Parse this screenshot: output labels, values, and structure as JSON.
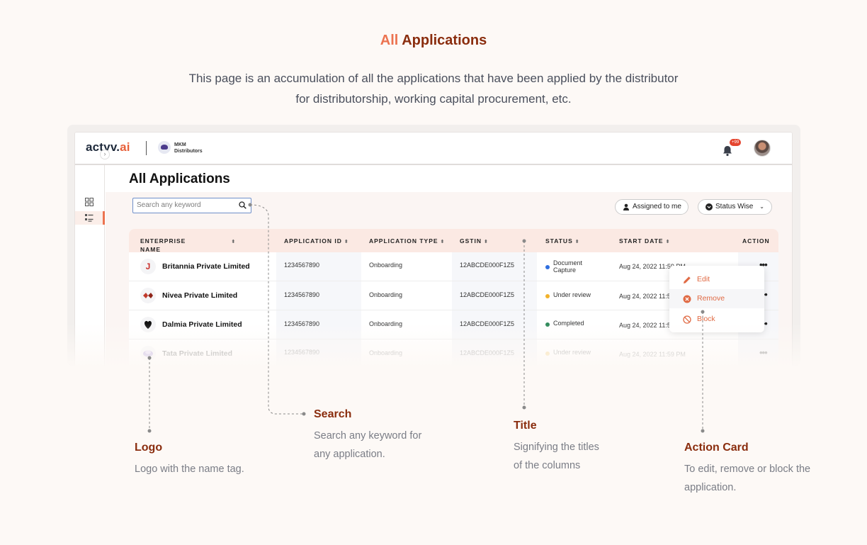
{
  "hero": {
    "title_accent": "All",
    "title_rest": "Applications",
    "description": "This page is an accumulation of all the applications that have been applied by the distributor for distributorship, working capital procurement, etc."
  },
  "app": {
    "brand_main": "actyv.",
    "brand_accent": "ai",
    "partner_line1": "MKM",
    "partner_line2": "Distributors",
    "notification_badge": "+99",
    "page_title": "All Applications",
    "search": {
      "placeholder": "Search any keyword"
    },
    "filters": {
      "assigned": "Assigned to me",
      "status": "Status Wise"
    },
    "columns": {
      "enterprise_line1": "ENTERPRISE",
      "enterprise_line2": "NAME",
      "application_id": "APPLICATION ID",
      "application_type": "APPLICATION TYPE",
      "gstin": "GSTIN",
      "status": "STATUS",
      "start_date": "START DATE",
      "action": "ACTION"
    },
    "rows": [
      {
        "company": "Britannia Private Limited",
        "id": "1234567890",
        "type": "Onboarding",
        "gstin": "12ABCDE000F1Z5",
        "status_line1": "Document",
        "status_line2": "Capture",
        "status_color": "#2f6fe0",
        "date": "Aug 24, 2022 11:59 PM"
      },
      {
        "company": "Nivea Private Limited",
        "id": "1234567890",
        "type": "Onboarding",
        "gstin": "12ABCDE000F1Z5",
        "status_line1": "Under review",
        "status_line2": "",
        "status_color": "#f2b22b",
        "date": "Aug 24, 2022 11:59 PM"
      },
      {
        "company": "Dalmia Private Limited",
        "id": "1234567890",
        "type": "Onboarding",
        "gstin": "12ABCDE000F1Z5",
        "status_line1": "Completed",
        "status_line2": "",
        "status_color": "#2f8a5a",
        "date": "Aug 24, 2022 11:59 PM"
      },
      {
        "company": "Tata Private Limited",
        "id": "1234567890",
        "type": "Onboarding",
        "gstin": "12ABCDE000F1Z5",
        "status_line1": "Under review",
        "status_line2": "",
        "status_color": "#f2b22b",
        "date": "Aug 24, 2022 11:59 PM"
      }
    ],
    "action_menu": {
      "edit": "Edit",
      "remove": "Remove",
      "block": "Block"
    },
    "accent_color": "#ec7350"
  },
  "callouts": {
    "logo": {
      "title": "Logo",
      "desc_line1": "Logo with the name tag."
    },
    "search": {
      "title": "Search",
      "desc_line1": "Search any keyword for",
      "desc_line2": "any application."
    },
    "title": {
      "title": "Title",
      "desc_line1": "Signifying the titles",
      "desc_line2": "of the columns"
    },
    "action_card": {
      "title": "Action Card",
      "desc_line1": "To edit, remove or block the",
      "desc_line2": "application."
    }
  }
}
